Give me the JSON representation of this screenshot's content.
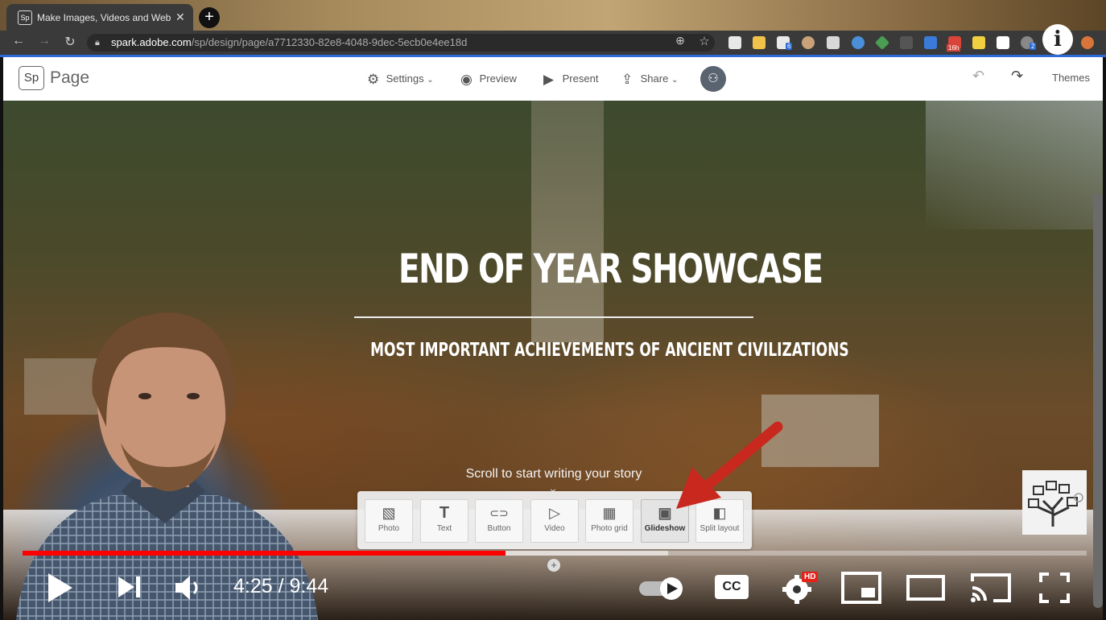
{
  "browser": {
    "tab_title": "Make Images, Videos and Web",
    "tab_favicon": "Sp",
    "new_tab_label": "+",
    "url_host": "spark.adobe.com",
    "url_path": "/sp/design/page/a7712330-82e8-4048-9dec-5ecb0e4ee18d",
    "ext_badge_6": "6",
    "ext_badge_16h": "16h",
    "ext_badge_2": "2",
    "info_label": "i"
  },
  "spark": {
    "logo_mark": "Sp",
    "logo_text": "Page",
    "settings_label": "Settings",
    "preview_label": "Preview",
    "present_label": "Present",
    "share_label": "Share",
    "themes_label": "Themes"
  },
  "hero": {
    "title": "END OF YEAR SHOWCASE",
    "subtitle": "MOST IMPORTANT ACHIEVEMENTS OF ANCIENT CIVILIZATIONS",
    "scroll_hint": "Scroll to start writing your story"
  },
  "tray": {
    "items": [
      {
        "label": "Photo",
        "glyph": "▧"
      },
      {
        "label": "Text",
        "glyph": "T"
      },
      {
        "label": "Button",
        "glyph": "⊂⊃"
      },
      {
        "label": "Video",
        "glyph": "▷"
      },
      {
        "label": "Photo grid",
        "glyph": "▦"
      },
      {
        "label": "Glideshow",
        "glyph": "▣"
      },
      {
        "label": "Split layout",
        "glyph": "◧"
      }
    ],
    "selected": "Glideshow"
  },
  "player": {
    "current_time": "4:25",
    "duration": "9:44",
    "time_display": "4:25 / 9:44",
    "played_fraction": 0.454,
    "buffered_fraction": 0.607,
    "cc_label": "CC",
    "hd_badge": "HD"
  },
  "colors": {
    "accent_blue": "#2c6bd8",
    "progress_red": "#ff0000",
    "arrow_red": "#c8281e"
  }
}
